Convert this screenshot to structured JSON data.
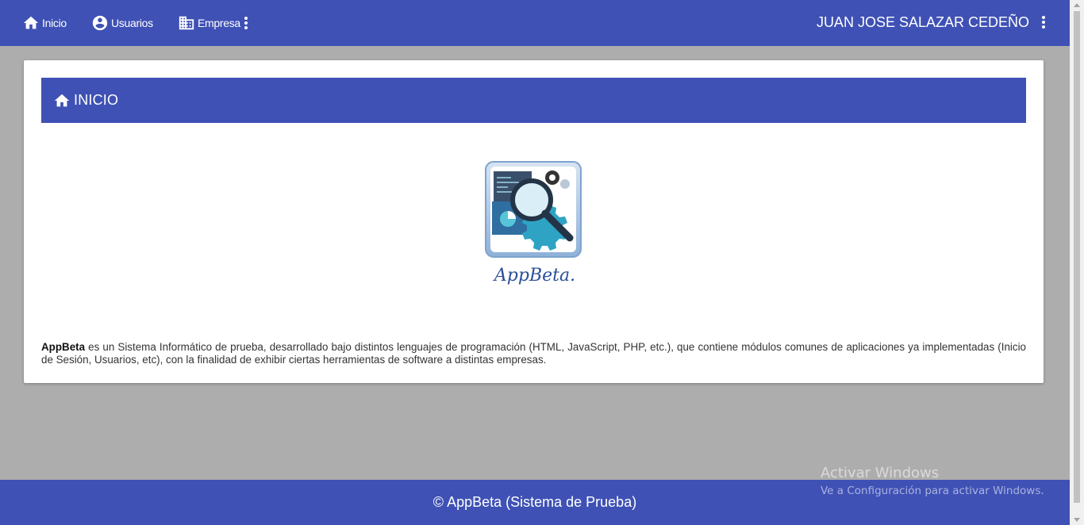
{
  "nav": {
    "home_label": "Inicio",
    "users_label": "Usuarios",
    "company_label": "Empresa",
    "user_name": "JUAN JOSE SALAZAR CEDEÑO"
  },
  "card": {
    "header_title": "INICIO",
    "logo_text": "AppBeta.",
    "description_bold": "AppBeta",
    "description_rest": " es un Sistema Informático de prueba, desarrollado bajo distintos lenguajes de programación (HTML, JavaScript, PHP, etc.), que contiene módulos comunes de aplicaciones ya implementadas (Inicio de Sesión, Usuarios, etc), con la finalidad de exhibir ciertas herramientas de software a distintas empresas."
  },
  "footer": {
    "text": "© AppBeta (Sistema de Prueba)"
  },
  "watermark": {
    "title": "Activar Windows",
    "subtitle": "Ve a Configuración para activar Windows."
  },
  "colors": {
    "primary": "#3f51b5",
    "background": "#adadad"
  }
}
